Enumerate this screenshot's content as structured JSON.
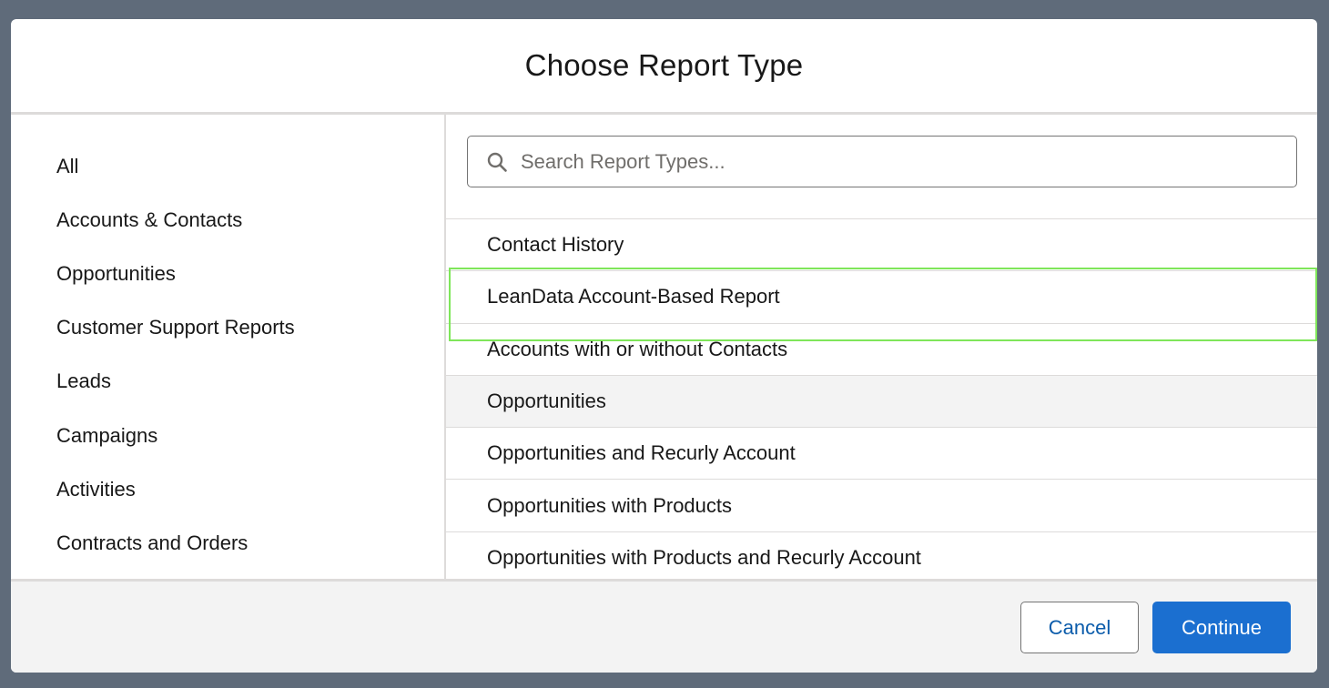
{
  "dialog": {
    "title": "Choose Report Type"
  },
  "categories": [
    {
      "label": "All"
    },
    {
      "label": "Accounts & Contacts"
    },
    {
      "label": "Opportunities"
    },
    {
      "label": "Customer Support Reports"
    },
    {
      "label": "Leads"
    },
    {
      "label": "Campaigns"
    },
    {
      "label": "Activities"
    },
    {
      "label": "Contracts and Orders"
    }
  ],
  "search": {
    "placeholder": "Search Report Types...",
    "value": "",
    "icon": "search-icon"
  },
  "report_types": [
    {
      "label": "Contact History",
      "selected": false
    },
    {
      "label": "LeanData Account-Based Report",
      "selected": false
    },
    {
      "label": "Accounts with or without Contacts",
      "selected": false
    },
    {
      "label": "Opportunities",
      "selected": true
    },
    {
      "label": "Opportunities and Recurly Account",
      "selected": false
    },
    {
      "label": "Opportunities with Products",
      "selected": false
    },
    {
      "label": "Opportunities with Products and Recurly Account",
      "selected": false
    }
  ],
  "footer": {
    "cancel_label": "Cancel",
    "continue_label": "Continue"
  },
  "colors": {
    "brand": "#1b6fd0",
    "link": "#0b5cab",
    "highlight": "#7fe65a",
    "overlay": "#5f6b7a"
  }
}
